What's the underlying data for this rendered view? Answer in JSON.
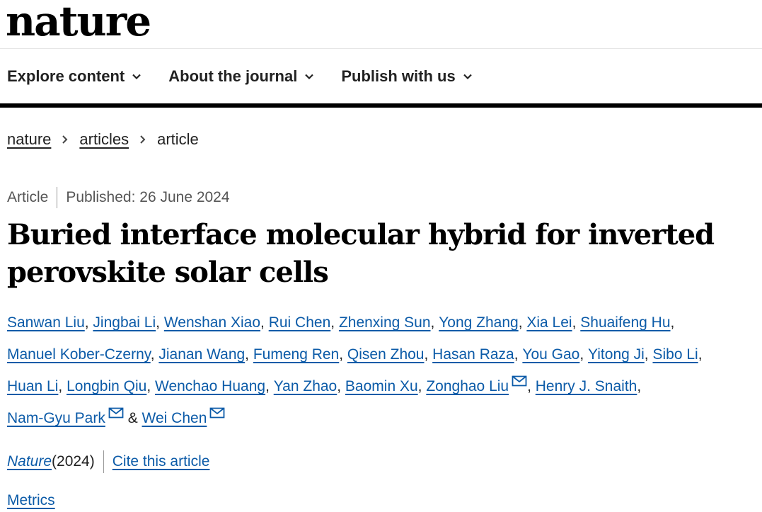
{
  "header": {
    "logo": "nature",
    "nav": [
      {
        "label": "Explore content"
      },
      {
        "label": "About the journal"
      },
      {
        "label": "Publish with us"
      }
    ]
  },
  "breadcrumb": {
    "items": [
      "nature",
      "articles",
      "article"
    ]
  },
  "article": {
    "type": "Article",
    "published": "Published: 26 June 2024",
    "title": "Buried interface molecular hybrid for inverted perovskite solar cells",
    "authors": [
      {
        "name": "Sanwan Liu",
        "suffix": ", ",
        "mail": false
      },
      {
        "name": "Jingbai Li",
        "suffix": ", ",
        "mail": false
      },
      {
        "name": "Wenshan Xiao",
        "suffix": ", ",
        "mail": false
      },
      {
        "name": "Rui Chen",
        "suffix": ", ",
        "mail": false
      },
      {
        "name": "Zhenxing Sun",
        "suffix": ", ",
        "mail": false
      },
      {
        "name": "Yong Zhang",
        "suffix": ", ",
        "mail": false
      },
      {
        "name": "Xia Lei",
        "suffix": ", ",
        "mail": false
      },
      {
        "name": "Shuaifeng Hu",
        "suffix": ", ",
        "mail": false
      },
      {
        "name": "Manuel Kober-Czerny",
        "suffix": ", ",
        "mail": false
      },
      {
        "name": "Jianan Wang",
        "suffix": ", ",
        "mail": false
      },
      {
        "name": "Fumeng Ren",
        "suffix": ", ",
        "mail": false
      },
      {
        "name": "Qisen Zhou",
        "suffix": ", ",
        "mail": false
      },
      {
        "name": "Hasan Raza",
        "suffix": ", ",
        "mail": false
      },
      {
        "name": "You Gao",
        "suffix": ", ",
        "mail": false
      },
      {
        "name": "Yitong Ji",
        "suffix": ", ",
        "mail": false
      },
      {
        "name": "Sibo Li",
        "suffix": ", ",
        "mail": false
      },
      {
        "name": "Huan Li",
        "suffix": ", ",
        "mail": false
      },
      {
        "name": "Longbin Qiu",
        "suffix": ", ",
        "mail": false
      },
      {
        "name": "Wenchao Huang",
        "suffix": ", ",
        "mail": false
      },
      {
        "name": "Yan Zhao",
        "suffix": ", ",
        "mail": false
      },
      {
        "name": "Baomin Xu",
        "suffix": ", ",
        "mail": false
      },
      {
        "name": "Zonghao Liu",
        "suffix": ", ",
        "mail": true
      },
      {
        "name": "Henry J. Snaith",
        "suffix": ", ",
        "mail": false
      },
      {
        "name": "Nam-Gyu Park",
        "suffix": " & ",
        "mail": true
      },
      {
        "name": "Wei Chen",
        "suffix": "",
        "mail": true
      }
    ],
    "journal": "Nature",
    "year": " (2024)",
    "cite_label": "Cite this article",
    "metrics_label": "Metrics"
  },
  "icons": {
    "nav_chevron": "chevron-down-icon",
    "breadcrumb_separator": "chevron-right-icon",
    "author_mail": "mail-icon"
  },
  "colors": {
    "link": "#0c5ba8",
    "text": "#222222",
    "rule": "#000000"
  }
}
